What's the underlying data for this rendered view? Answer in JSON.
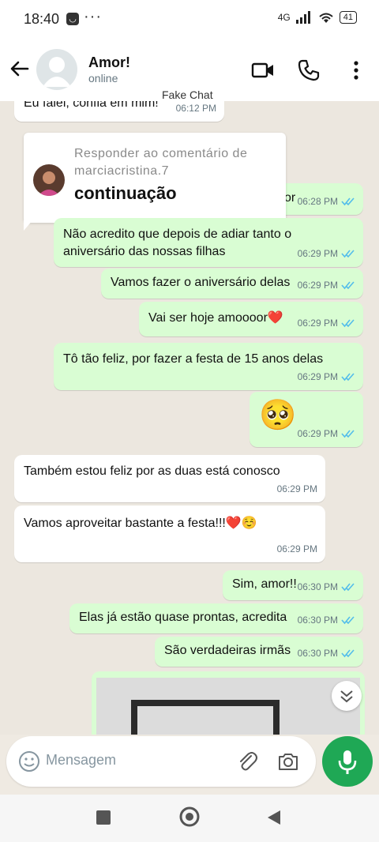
{
  "status_bar": {
    "time": "18:40",
    "network": "4G",
    "battery": "41"
  },
  "header": {
    "title": "Amor!",
    "subtitle": "online",
    "watermark": "Fake Chat"
  },
  "icons": [
    "back-arrow-icon",
    "video-call-icon",
    "phone-icon",
    "more-vert-icon",
    "emoji-icon",
    "attach-icon",
    "camera-icon",
    "mic-icon",
    "chevron-down-icon"
  ],
  "colors": {
    "incoming": "#ffffff",
    "outgoing": "#d9fdd3",
    "read_ticks": "#53bdeb",
    "accent": "#1fa855",
    "background": "#efeae2"
  },
  "messages": [
    {
      "dir": "in",
      "text": "Eu falei, confia em mim!",
      "time": "06:12 PM"
    },
    {
      "dir": "out",
      "text": "or",
      "time": "06:28 PM",
      "reply": {
        "header": "Responder ao comentário de marciacristina.7",
        "text": "continuação"
      }
    },
    {
      "dir": "out",
      "text": "Não acredito que depois de adiar tanto o aniversário das nossas filhas",
      "time": "06:29 PM"
    },
    {
      "dir": "out",
      "text": "Vamos fazer o aniversário delas",
      "time": "06:29 PM"
    },
    {
      "dir": "out",
      "text": "Vai ser hoje amoooor❤️",
      "time": "06:29 PM"
    },
    {
      "dir": "out",
      "text": "Tô tão feliz, por fazer a festa de 15 anos delas",
      "time": "06:29 PM"
    },
    {
      "dir": "out",
      "text": "🥺",
      "time": "06:29 PM"
    },
    {
      "dir": "in",
      "text": "Também estou feliz por as duas está conosco",
      "time": "06:29 PM"
    },
    {
      "dir": "in",
      "text": "Vamos aproveitar bastante a festa!!!❤️☺️",
      "time": "06:29 PM"
    },
    {
      "dir": "out",
      "text": "Sim, amor!!",
      "time": "06:30 PM"
    },
    {
      "dir": "out",
      "text": "Elas já estão quase prontas, acredita",
      "time": "06:30 PM"
    },
    {
      "dir": "out",
      "text": "São verdadeiras irmãs",
      "time": "06:30 PM"
    }
  ],
  "composer": {
    "placeholder": "Mensagem"
  }
}
